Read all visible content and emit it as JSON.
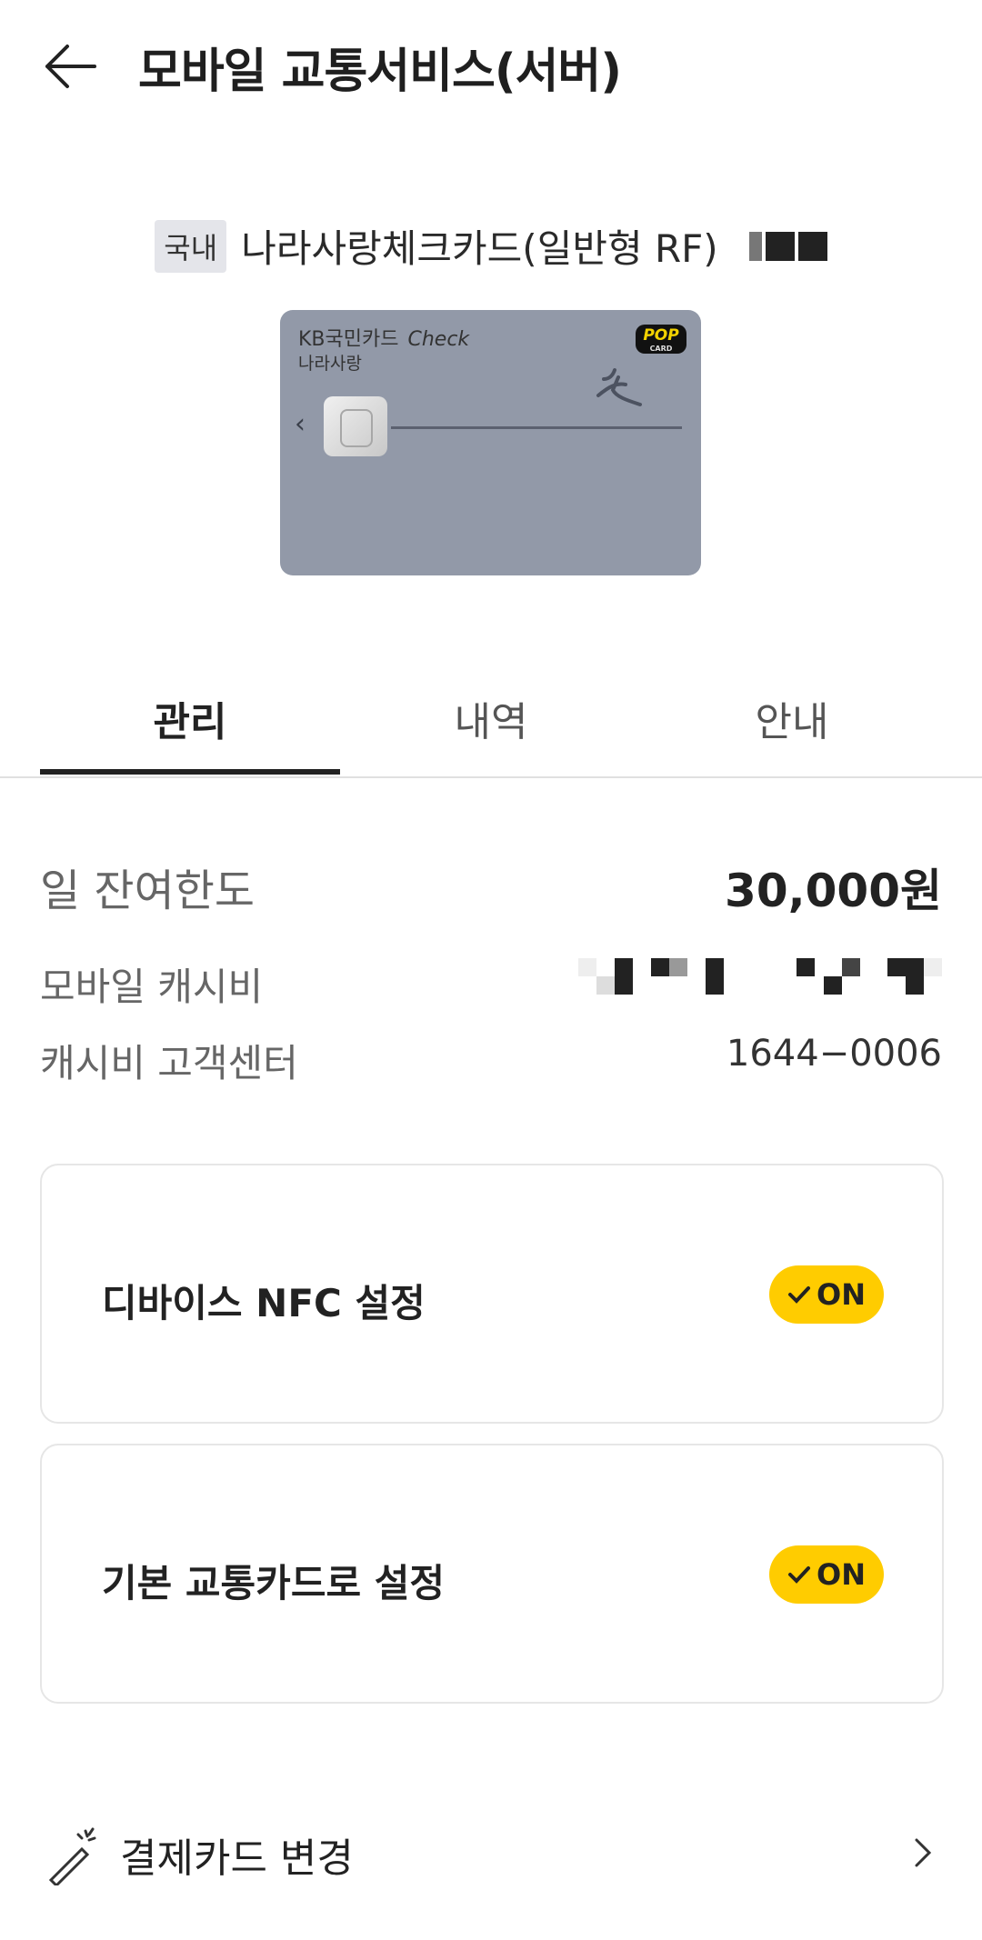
{
  "header": {
    "title": "모바일 교통서비스(서버)"
  },
  "card": {
    "region_badge": "국내",
    "name": "나라사랑체크카드(일반형 RF)",
    "image": {
      "brand": "KB국민카드",
      "brand_suffix": "Check",
      "subtitle": "나라사랑",
      "pop_text": "POP",
      "pop_sub": "CARD",
      "color": "#9299a8"
    }
  },
  "tabs": [
    {
      "label": "관리",
      "active": true
    },
    {
      "label": "내역",
      "active": false
    },
    {
      "label": "안내",
      "active": false
    }
  ],
  "info": {
    "daily_limit_label": "일 잔여한도",
    "daily_limit_value": "30,000원",
    "cashbee_label": "모바일 캐시비",
    "center_label": "캐시비 고객센터",
    "center_phone": "1644−0006"
  },
  "settings": [
    {
      "label": "디바이스 NFC 설정",
      "toggle": "ON"
    },
    {
      "label": "기본 교통카드로 설정",
      "toggle": "ON"
    }
  ],
  "change_card": {
    "label": "결제카드 변경"
  },
  "colors": {
    "accent": "#ffcc00",
    "text": "#222222"
  }
}
